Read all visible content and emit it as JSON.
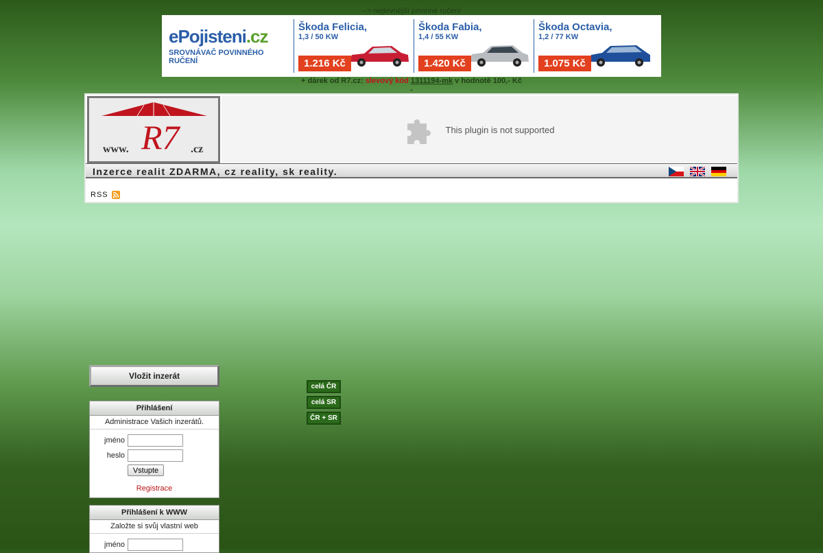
{
  "top_link": "--> nejlevnější povinné ručení",
  "banner": {
    "brand": "ePojisteni.cz",
    "brand_prefix": "e",
    "brand_main": "Pojisteni",
    "brand_suffix": ".cz",
    "brand_sub": "SROVNÁVAČ POVINNÉHO RUČENÍ",
    "offers": [
      {
        "name": "Škoda Felicia,",
        "spec": "1,3 / 50 KW",
        "price": "1.216 Kč",
        "car_color": "#c81e34"
      },
      {
        "name": "Škoda Fabia,",
        "spec": "1,4 / 55 KW",
        "price": "1.420 Kč",
        "car_color": "#b8bcc0"
      },
      {
        "name": "Škoda Octavia,",
        "spec": "1,2 / 77 KW",
        "price": "1.075 Kč",
        "car_color": "#1f4f9a"
      }
    ]
  },
  "gift": {
    "prefix": "+ dárek od R7.cz: ",
    "label": "slevový kód",
    "code": "1311194-mk",
    "suffix": " v hodnotě 100,- Kč",
    "line2": "-"
  },
  "header": {
    "logo_www": "www.",
    "logo_r7": "R7",
    "logo_cz": ".cz",
    "plugin_message": "This plugin is not supported",
    "tagline": "Inzerce realit ZDARMA, cz reality, sk reality.",
    "rss": "RSS"
  },
  "sidebar": {
    "add_button": "Vložit inzerát",
    "login": {
      "title": "Přihlášení",
      "subtitle": "Administrace Vašich inzerátů.",
      "name_label": "jméno",
      "name_value": "",
      "password_label": "heslo",
      "password_value": "",
      "submit": "Vstupte",
      "register": "Registrace"
    },
    "www_login": {
      "title": "Přihlášení k WWW",
      "subtitle": "Založte si svůj vlastní web",
      "name_label": "jméno",
      "name_value": ""
    }
  },
  "regions": [
    "celá ČR",
    "celá SR",
    "ČR + SR"
  ],
  "colors": {
    "accent_red": "#c0141e",
    "banner_blue": "#2a5ea8",
    "price_orange": "#e2401e",
    "bg_green_dark": "#2a5416",
    "bg_green_light": "#b4e6bd"
  }
}
